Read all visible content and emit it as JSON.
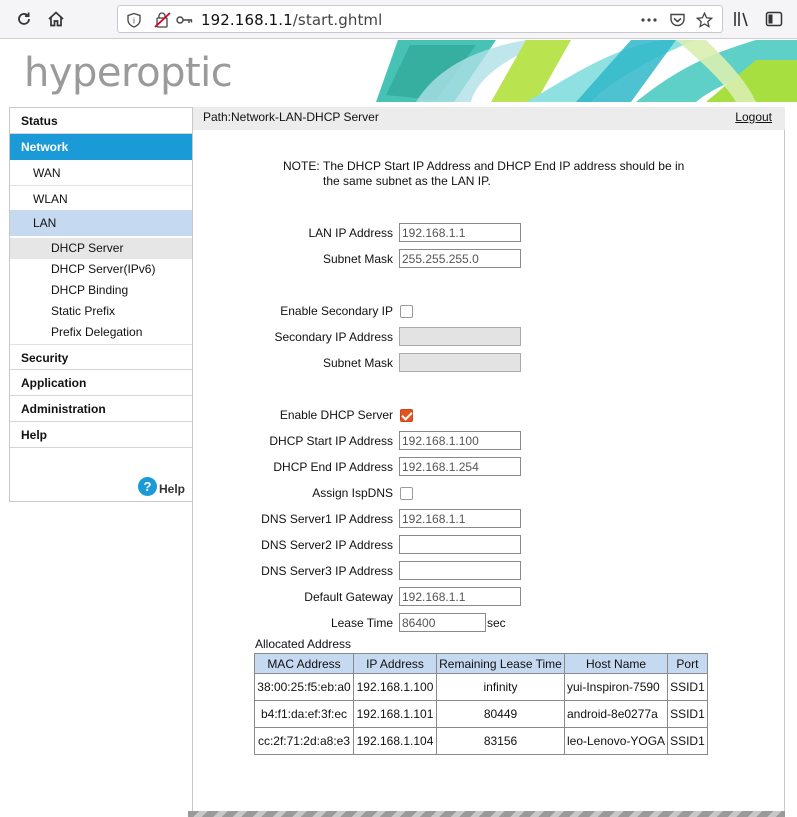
{
  "browser": {
    "url_host": "192.168.1.1",
    "url_path": "/start.ghtml"
  },
  "brand": {
    "logo_text": "hyperoptic"
  },
  "sidebar": {
    "items": [
      {
        "label": "Status"
      },
      {
        "label": "Network"
      },
      {
        "label": "WAN"
      },
      {
        "label": "WLAN"
      },
      {
        "label": "LAN"
      },
      {
        "label": "DHCP Server"
      },
      {
        "label": "DHCP Server(IPv6)"
      },
      {
        "label": "DHCP Binding"
      },
      {
        "label": "Static Prefix"
      },
      {
        "label": "Prefix Delegation"
      },
      {
        "label": "Security"
      },
      {
        "label": "Application"
      },
      {
        "label": "Administration"
      },
      {
        "label": "Help"
      }
    ],
    "help_icon_glyph": "?",
    "help_label": "Help"
  },
  "header": {
    "path": "Path:Network-LAN-DHCP Server",
    "logout": "Logout"
  },
  "note": {
    "label": "NOTE:",
    "text": "The DHCP Start IP Address and DHCP End IP address should be in the same subnet as the LAN IP."
  },
  "form": {
    "lan_ip_label": "LAN IP Address",
    "lan_ip_value": "192.168.1.1",
    "subnet_mask_label": "Subnet Mask",
    "subnet_mask_value": "255.255.255.0",
    "enable_secondary_label": "Enable Secondary IP",
    "enable_secondary_checked": false,
    "secondary_ip_label": "Secondary IP Address",
    "secondary_ip_value": "",
    "secondary_mask_label": "Subnet Mask",
    "secondary_mask_value": "",
    "enable_dhcp_label": "Enable DHCP Server",
    "enable_dhcp_checked": true,
    "dhcp_start_label": "DHCP Start IP Address",
    "dhcp_start_value": "192.168.1.100",
    "dhcp_end_label": "DHCP End IP Address",
    "dhcp_end_value": "192.168.1.254",
    "assign_isp_dns_label": "Assign IspDNS",
    "assign_isp_dns_checked": false,
    "dns1_label": "DNS Server1 IP Address",
    "dns1_value": "192.168.1.1",
    "dns2_label": "DNS Server2 IP Address",
    "dns2_value": "",
    "dns3_label": "DNS Server3 IP Address",
    "dns3_value": "",
    "gateway_label": "Default Gateway",
    "gateway_value": "192.168.1.1",
    "lease_label": "Lease Time",
    "lease_value": "86400",
    "lease_unit": "sec"
  },
  "allocated": {
    "title": "Allocated Address",
    "columns": [
      "MAC Address",
      "IP Address",
      "Remaining Lease Time",
      "Host Name",
      "Port"
    ],
    "rows": [
      [
        "38:00:25:f5:eb:a0",
        "192.168.1.100",
        "infinity",
        "yui-Inspiron-7590",
        "SSID1"
      ],
      [
        "b4:f1:da:ef:3f:ec",
        "192.168.1.101",
        "80449",
        "android-8e0277a",
        "SSID1"
      ],
      [
        "cc:2f:71:2d:a8:e3",
        "192.168.1.104",
        "83156",
        "leo-Lenovo-YOGA",
        "SSID1"
      ]
    ]
  },
  "colors": {
    "accent": "#1a9bd7",
    "selected_row": "#c5d9f1",
    "checkbox_checked": "#e2541b"
  },
  "icons": {
    "reload": "reload-icon",
    "home": "home-icon",
    "site_info": "info-icon",
    "tracking": "tracking-protection-icon",
    "key": "key-icon",
    "more": "more-icon",
    "pocket": "pocket-icon",
    "bookmark": "star-icon",
    "library": "library-icon",
    "sidebar": "sidebar-icon"
  }
}
